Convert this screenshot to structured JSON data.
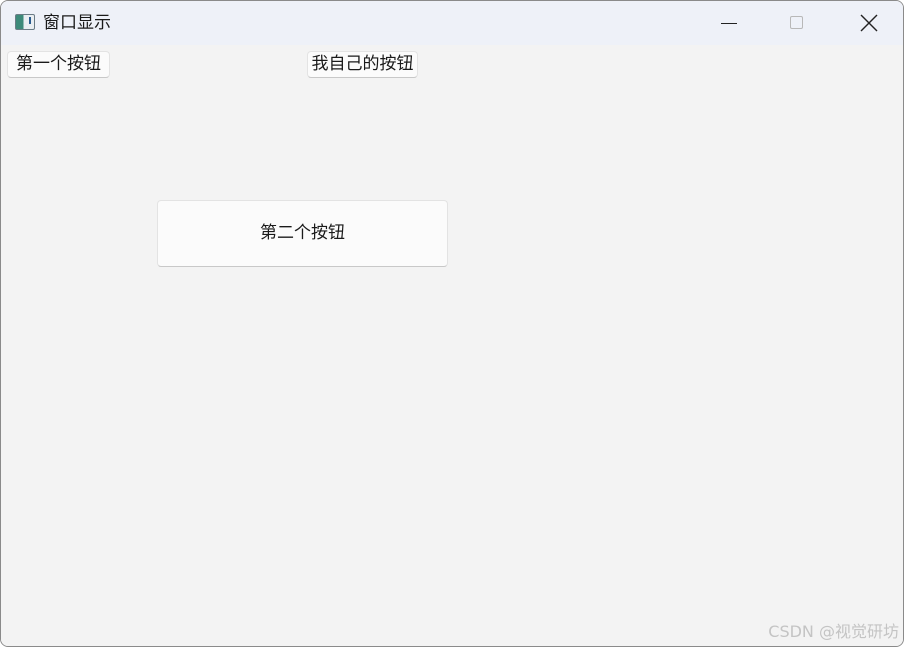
{
  "window": {
    "title": "窗口显示",
    "icon": "app-window-icon",
    "controls": {
      "minimize_icon": "minimize-icon",
      "maximize_icon": "maximize-icon",
      "close_icon": "close-icon"
    }
  },
  "buttons": {
    "first": "第一个按钮",
    "mine": "我自己的按钮",
    "second": "第二个按钮"
  },
  "watermark": "CSDN @视觉研坊",
  "colors": {
    "titlebar_bg": "#eef1f8",
    "client_bg": "#f3f3f3",
    "button_bg": "#fbfbfb"
  }
}
